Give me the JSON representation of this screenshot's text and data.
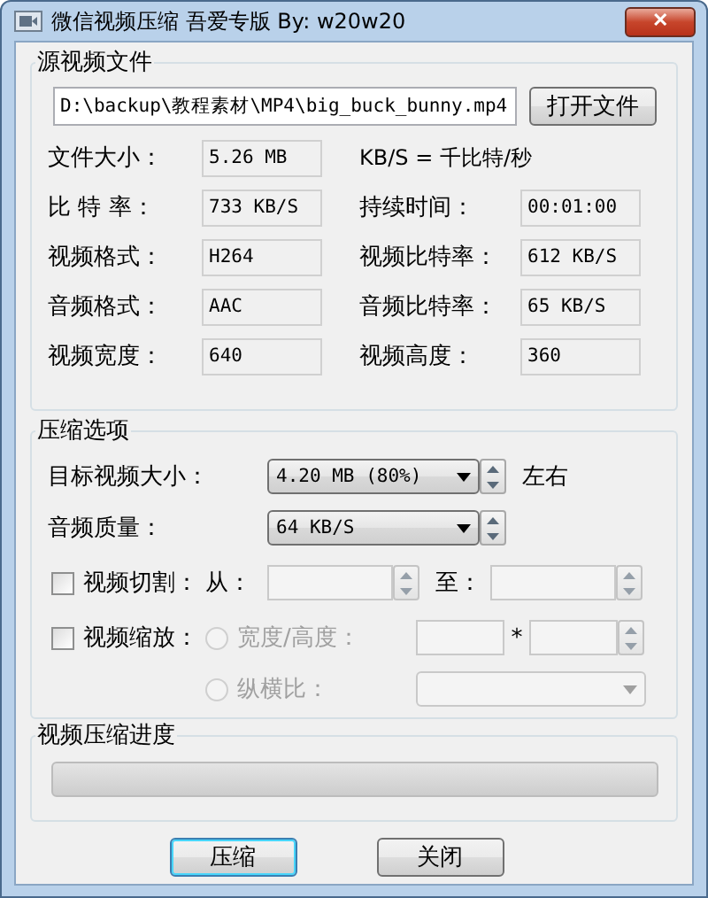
{
  "window": {
    "title": "微信视频压缩  吾爱专版 By: w20w20",
    "close": "✕"
  },
  "source": {
    "legend": "源视频文件",
    "path": "D:\\backup\\教程素材\\MP4\\big_buck_bunny.mp4",
    "open_button": "打开文件",
    "rows": [
      {
        "left": {
          "label": "文件大小：",
          "value": "5.26 MB"
        },
        "right": {
          "kind": "note",
          "text": "KB/S = 千比特/秒"
        }
      },
      {
        "left": {
          "label": "比 特 率：",
          "value": "733 KB/S"
        },
        "right": {
          "kind": "field",
          "label": "持续时间：",
          "value": "00:01:00"
        }
      },
      {
        "left": {
          "label": "视频格式：",
          "value": "H264"
        },
        "right": {
          "kind": "field",
          "label": "视频比特率：",
          "value": "612 KB/S"
        }
      },
      {
        "left": {
          "label": "音频格式：",
          "value": "AAC"
        },
        "right": {
          "kind": "field",
          "label": "音频比特率：",
          "value": "65 KB/S"
        }
      },
      {
        "left": {
          "label": "视频宽度：",
          "value": "640"
        },
        "right": {
          "kind": "field",
          "label": "视频高度：",
          "value": "360"
        }
      }
    ]
  },
  "options": {
    "legend": "压缩选项",
    "target": {
      "label": "目标视频大小：",
      "value": "4.20 MB (80%)",
      "suffix": "左右"
    },
    "audio": {
      "label": "音频质量：",
      "value": "64 KB/S"
    },
    "cut": {
      "label": "视频切割：",
      "checked": false,
      "from_label": "从：",
      "to_label": "至："
    },
    "scale": {
      "label": "视频缩放：",
      "checked": false,
      "times": "*",
      "choices": [
        {
          "kind": "size",
          "label": "宽度/高度：",
          "selected": false,
          "disabled": true
        },
        {
          "kind": "ratio",
          "label": "纵横比：",
          "selected": false,
          "disabled": true
        }
      ]
    }
  },
  "progress": {
    "legend": "视频压缩进度",
    "level": 0
  },
  "buttons": [
    {
      "label": "压缩",
      "default": true
    },
    {
      "label": "关闭",
      "default": false
    }
  ]
}
